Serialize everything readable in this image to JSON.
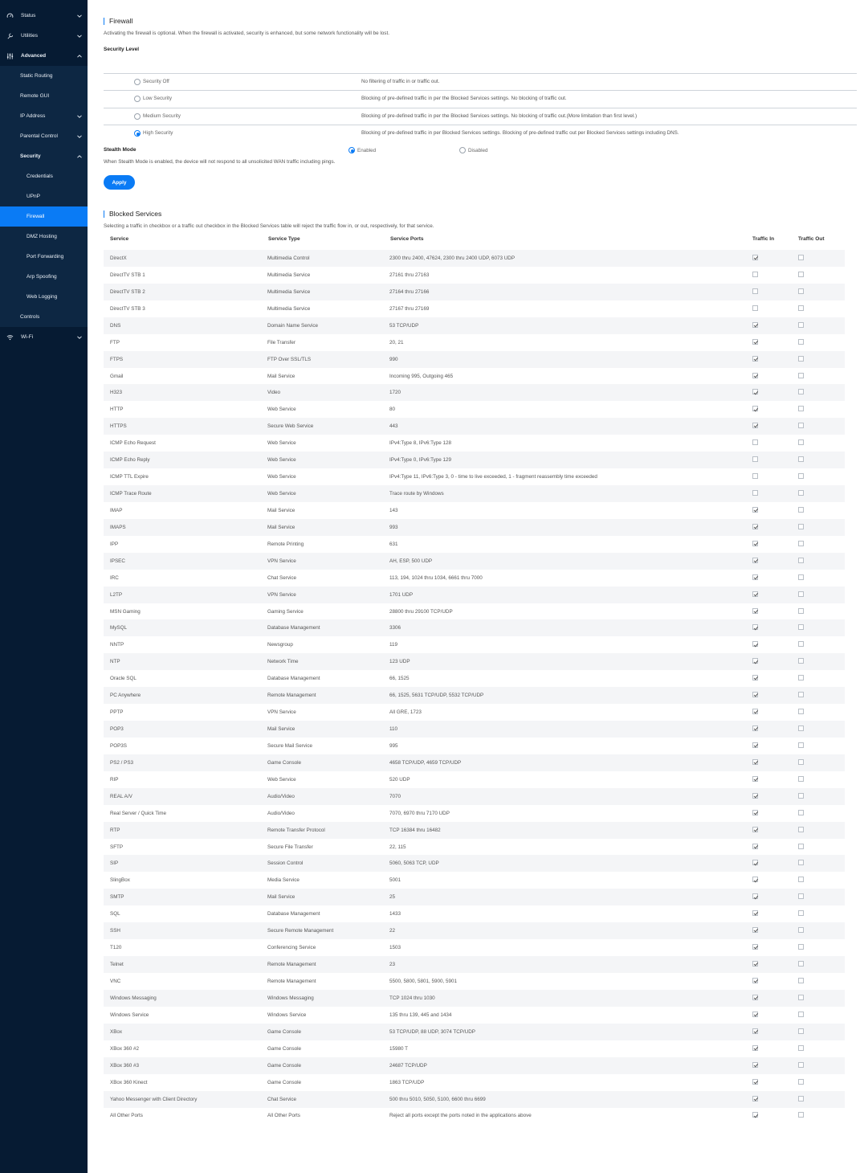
{
  "sidebar": {
    "items": [
      {
        "label": "Status",
        "icon": "gauge-icon"
      },
      {
        "label": "Utilities",
        "icon": "wrench-icon"
      },
      {
        "label": "Advanced",
        "icon": "sliders-icon"
      },
      {
        "label": "Static Routing"
      },
      {
        "label": "Remote GUI"
      },
      {
        "label": "IP Address"
      },
      {
        "label": "Parental Control"
      },
      {
        "label": "Security"
      },
      {
        "label": "Credentials"
      },
      {
        "label": "UPnP"
      },
      {
        "label": "Firewall"
      },
      {
        "label": "DMZ Hosting"
      },
      {
        "label": "Port Forwarding"
      },
      {
        "label": "Arp Spoofing"
      },
      {
        "label": "Web Logging"
      },
      {
        "label": "Controls"
      },
      {
        "label": "Wi-Fi",
        "icon": "wifi-icon"
      }
    ]
  },
  "firewall": {
    "title": "Firewall",
    "description": "Activating the firewall is optional. When the firewall is activated, security is enhanced, but some network functionality will be lost.",
    "security_level_label": "Security Level",
    "levels": [
      {
        "label": "Security Off",
        "desc": "No filtering of traffic in or traffic out."
      },
      {
        "label": "Low Security",
        "desc": "Blocking of pre-defined traffic in per the Blocked Services settings.  No blocking of traffic out."
      },
      {
        "label": "Medium Security",
        "desc": "Blocking of pre-defined traffic in per the Blocked Services settings.  No blocking of traffic out.(More limitation than first level.)"
      },
      {
        "label": "High Security",
        "desc": "Blocking of pre-defined traffic in per Blocked Services settings.  Blocking of pre-defined traffic out per Blocked Services settings including DNS."
      }
    ],
    "selected_level": "High Security",
    "stealth_label": "Stealth Mode",
    "stealth_enabled": "Enabled",
    "stealth_disabled": "Disabled",
    "stealth_desc": "When Stealth Mode is enabled, the device will not respond to all unsolicited WAN traffic including pings.",
    "apply_label": "Apply"
  },
  "blocked": {
    "title": "Blocked Services",
    "description": "Selecting a traffic in checkbox or a traffic out checkbox in the Blocked Services table will reject the traffic flow in, or out, respectively, for that service.",
    "headers": [
      "Service",
      "Service Type",
      "Service Ports",
      "Traffic In",
      "Traffic Out"
    ],
    "rows": [
      [
        "DirectX",
        "Multimedia Control",
        "2300 thru 2400, 47624, 2300 thru 2400 UDP, 6073 UDP",
        true,
        false
      ],
      [
        "DirectTV STB 1",
        "Multimedia Service",
        "27161 thru 27163",
        false,
        false
      ],
      [
        "DirectTV STB 2",
        "Multimedia Service",
        "27164 thru 27166",
        false,
        false
      ],
      [
        "DirectTV STB 3",
        "Multimedia Service",
        "27167 thru 27169",
        false,
        false
      ],
      [
        "DNS",
        "Domain Name Service",
        "53 TCP/UDP",
        true,
        false
      ],
      [
        "FTP",
        "File Transfer",
        "20, 21",
        true,
        false
      ],
      [
        "FTPS",
        "FTP Over SSL/TLS",
        "990",
        true,
        false
      ],
      [
        "Gmail",
        "Mail Service",
        "Incoming 995, Outgoing 465",
        true,
        false
      ],
      [
        "H323",
        "Video",
        "1720",
        true,
        false
      ],
      [
        "HTTP",
        "Web Service",
        "80",
        true,
        false
      ],
      [
        "HTTPS",
        "Secure Web Service",
        "443",
        true,
        false
      ],
      [
        "ICMP Echo Request",
        "Web Service",
        "IPv4:Type 8, IPv6:Type 128",
        false,
        false
      ],
      [
        "ICMP Echo Reply",
        "Web Service",
        "IPv4:Type 0, IPv6:Type 129",
        false,
        false
      ],
      [
        "ICMP TTL Expire",
        "Web Service",
        "IPv4:Type 11, IPv6:Type 3, 0 - time to live exceeded, 1 - fragment reassembly time exceeded",
        false,
        false
      ],
      [
        "ICMP Trace Route",
        "Web Service",
        "Trace route by Windows",
        false,
        false
      ],
      [
        "IMAP",
        "Mail Service",
        "143",
        true,
        false
      ],
      [
        "IMAPS",
        "Mail Service",
        "993",
        true,
        false
      ],
      [
        "IPP",
        "Remote Printing",
        "631",
        true,
        false
      ],
      [
        "IPSEC",
        "VPN Service",
        "AH, ESP, 500 UDP",
        true,
        false
      ],
      [
        "IRC",
        "Chat Service",
        "113, 194, 1024 thru 1034, 6661 thru 7000",
        true,
        false
      ],
      [
        "L2TP",
        "VPN Service",
        "1701 UDP",
        true,
        false
      ],
      [
        "MSN Gaming",
        "Gaming Service",
        "28800 thru 29100 TCP/UDP",
        true,
        false
      ],
      [
        "MySQL",
        "Database Management",
        "3306",
        true,
        false
      ],
      [
        "NNTP",
        "Newsgroup",
        "119",
        true,
        false
      ],
      [
        "NTP",
        "Network Time",
        "123 UDP",
        true,
        false
      ],
      [
        "Oracle SQL",
        "Database Management",
        "66, 1525",
        true,
        false
      ],
      [
        "PC Anywhere",
        "Remote Management",
        "66, 1525, 5631 TCP/UDP, 5532 TCP/UDP",
        true,
        false
      ],
      [
        "PPTP",
        "VPN Service",
        "All GRE, 1723",
        true,
        false
      ],
      [
        "POP3",
        "Mail Service",
        "110",
        true,
        false
      ],
      [
        "POP3S",
        "Secure Mail Service",
        "995",
        true,
        false
      ],
      [
        "PS2 / PS3",
        "Game Console",
        "4658 TCP/UDP, 4659 TCP/UDP",
        true,
        false
      ],
      [
        "RIP",
        "Web Service",
        "520 UDP",
        true,
        false
      ],
      [
        "REAL A/V",
        "Audio/Video",
        "7070",
        true,
        false
      ],
      [
        "Real Server / Quick Time",
        "Audio/Video",
        "7070, 6970 thru 7170 UDP",
        true,
        false
      ],
      [
        "RTP",
        "Remote Transfer Protocol",
        "TCP 16384 thru 16482",
        true,
        false
      ],
      [
        "SFTP",
        "Secure File Transfer",
        "22, 115",
        true,
        false
      ],
      [
        "SIP",
        "Session Control",
        "5060, 5063 TCP, UDP",
        true,
        false
      ],
      [
        "SlingBox",
        "Media Service",
        "5001",
        true,
        false
      ],
      [
        "SMTP",
        "Mail Service",
        "25",
        true,
        false
      ],
      [
        "SQL",
        "Database Management",
        "1433",
        true,
        false
      ],
      [
        "SSH",
        "Secure Remote Management",
        "22",
        true,
        false
      ],
      [
        "T120",
        "Conferencing Service",
        "1503",
        true,
        false
      ],
      [
        "Telnet",
        "Remote Management",
        "23",
        true,
        false
      ],
      [
        "VNC",
        "Remote Management",
        "5500, 5800, 5801, 5900, 5901",
        true,
        false
      ],
      [
        "Windows Messaging",
        "Windows Messaging",
        "TCP 1024 thru 1030",
        true,
        false
      ],
      [
        "Windows Service",
        "Windows Service",
        "135 thru 139, 445 and 1434",
        true,
        false
      ],
      [
        "XBox",
        "Game Console",
        "53 TCP/UDP, 88 UDP, 3074 TCP/UDP",
        true,
        false
      ],
      [
        "XBox 360 #2",
        "Game Console",
        "15980 T",
        true,
        false
      ],
      [
        "XBox 360 #3",
        "Game Console",
        "24687 TCP/UDP",
        true,
        false
      ],
      [
        "XBox 360 Kinect",
        "Game Console",
        "1863 TCP/UDP",
        true,
        false
      ],
      [
        "Yahoo Messenger with Client Directory",
        "Chat Service",
        "500 thru 5010, 5050, 5100, 6600 thru 6699",
        true,
        false
      ],
      [
        "All Other Ports",
        "All Other Ports",
        "Reject all ports except the ports noted in the applications above",
        true,
        false
      ]
    ]
  },
  "colors": {
    "sidebar_bg": "#061b33",
    "accent": "#0a7bf5"
  }
}
